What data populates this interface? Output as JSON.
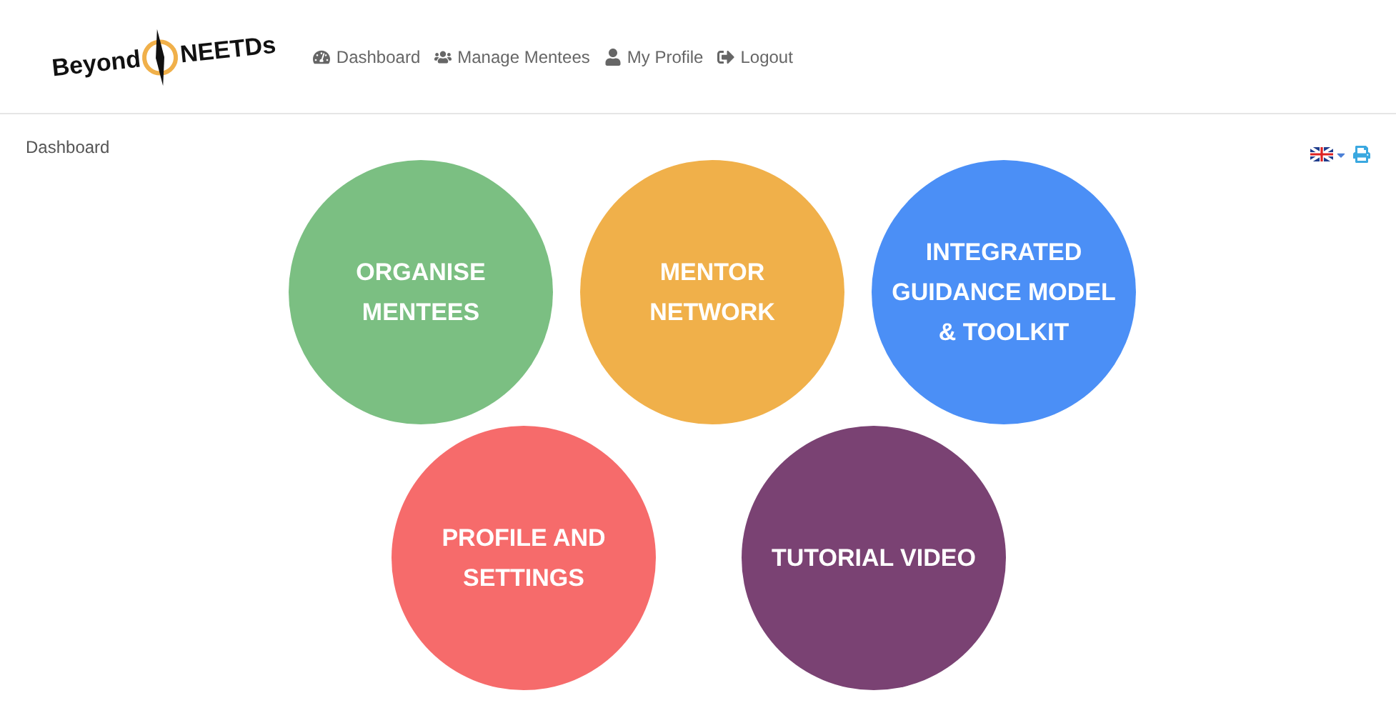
{
  "logo": {
    "left": "Beyond",
    "right": "NEETDs"
  },
  "nav": [
    {
      "label": "Dashboard",
      "kind": "dashboard"
    },
    {
      "label": "Manage Mentees",
      "kind": "mentees"
    },
    {
      "label": "My Profile",
      "kind": "profile"
    },
    {
      "label": "Logout",
      "kind": "logout"
    }
  ],
  "breadcrumb": "Dashboard",
  "tiles": [
    [
      {
        "lines": [
          "ORGANISE",
          "MENTEES"
        ],
        "color": "#7bbf82"
      },
      {
        "lines": [
          "MENTOR",
          "NETWORK"
        ],
        "color": "#f0b04a"
      },
      {
        "lines": [
          "INTEGRATED",
          "GUIDANCE MODEL",
          "& TOOLKIT"
        ],
        "color": "#4b8ff6"
      }
    ],
    [
      {
        "lines": [
          "PROFILE AND",
          "SETTINGS"
        ],
        "color": "#f66b6b"
      },
      {
        "lines": [
          "TUTORIAL VIDEO"
        ],
        "color": "#7a4273"
      }
    ]
  ]
}
